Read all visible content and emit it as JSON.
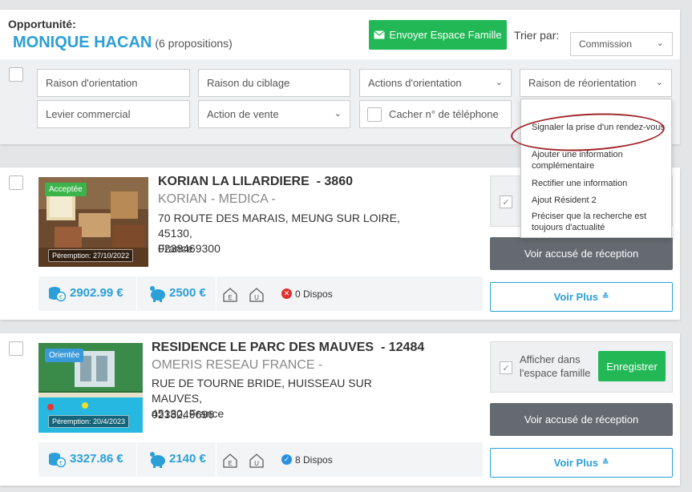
{
  "header": {
    "opportunity_label": "Opportunité:",
    "client_name": "MONIQUE HACAN",
    "proposals_count": "(6 propositions)",
    "send_button": "Envoyer Espace Famille",
    "sort_label": "Trier par:",
    "sort_value": "Commission"
  },
  "filters": {
    "raison_orientation": "Raison d'orientation",
    "raison_ciblage": "Raison du ciblage",
    "actions_orientation": "Actions d'orientation",
    "raison_reorientation": "Raison de réorientation",
    "levier_commercial": "Levier commercial",
    "action_vente": "Action de vente",
    "cacher_telephone": "Cacher n° de téléphone"
  },
  "dropdown": {
    "items": [
      "Signaler la prise d'un rendez-vous",
      "Ajouter une information complémentaire",
      "Rectifier une information",
      "Ajout Résident 2",
      "Préciser que la recherche est toujours d'actualité"
    ]
  },
  "colors": {
    "accent_blue": "#2a9fd8",
    "green": "#22b856",
    "badge_accepted": "#3cb44b",
    "badge_oriented": "#3a9ad9",
    "dispo_none": "#e03030",
    "dispo_ok": "#2a8fe0"
  },
  "cards": [
    {
      "status_badge": "Acceptée",
      "peremption": "Péremption: 27/10/2022",
      "name": "KORIAN LA LILARDIERE",
      "id": "- 3860",
      "group": "KORIAN - MEDICA -",
      "address_line1": "70 ROUTE DES MARAIS, MEUNG SUR LOIRE, 45130,",
      "address_line2": "France",
      "phone": "0238469300",
      "price1": "2902.99 €",
      "price2": "2500 €",
      "dispos": "0 Dispos",
      "dispo_icon": "x-circle-icon",
      "voir_accuse": "Voir accusé de réception",
      "voir_plus": "Voir Plus"
    },
    {
      "status_badge": "Orientée",
      "peremption": "Péremption: 20/4/2023",
      "name": "RESIDENCE LE PARC DES MAUVES",
      "id": "- 12484",
      "group": "OMERIS RESEAU FRANCE -",
      "address_line1": "RUE DE TOURNE BRIDE, HUISSEAU SUR MAUVES,",
      "address_line2": "45130, France",
      "phone": "0238249696",
      "price1": "3327.86 €",
      "price2": "2140 €",
      "dispos": "8 Dispos",
      "dispo_icon": "check-circle-icon",
      "family_label_1": "Afficher dans",
      "family_label_2": "l'espace famille",
      "save_button": "Enregistrer",
      "voir_accuse": "Voir accusé de réception",
      "voir_plus": "Voir Plus"
    }
  ]
}
